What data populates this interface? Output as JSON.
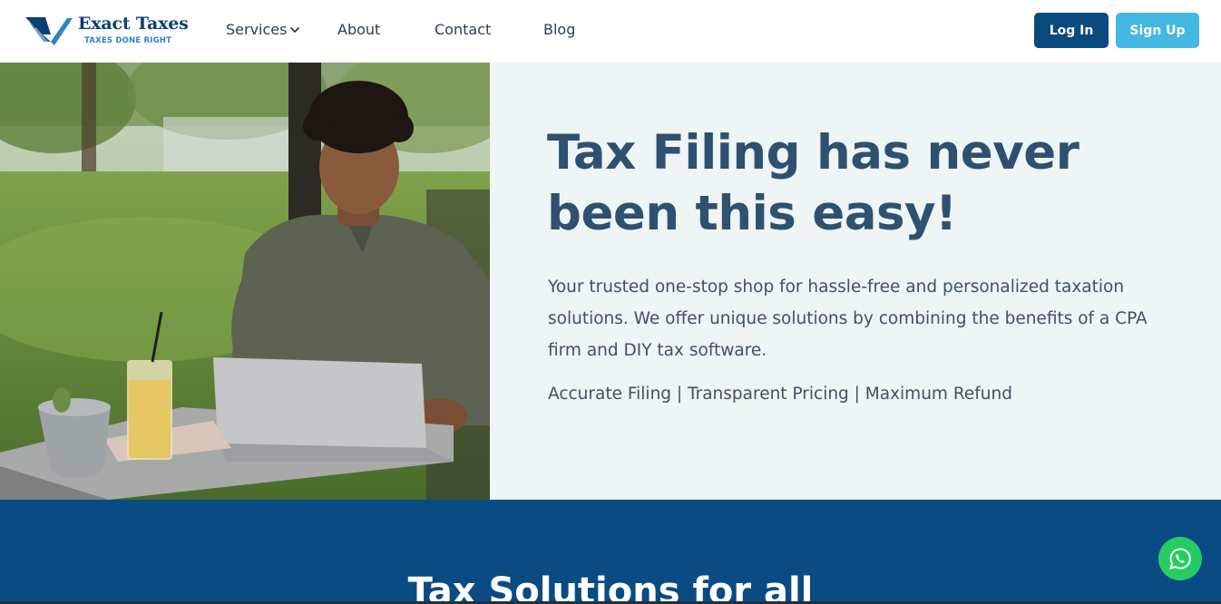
{
  "brand": {
    "name": "Exact Taxes",
    "tagline": "TAXES DONE RIGHT",
    "logo_icon": "checkmark-chevron-logo",
    "color_primary": "#0b3f73",
    "color_accent": "#2b85c5"
  },
  "nav": {
    "items": [
      {
        "label": "Services",
        "has_dropdown": true
      },
      {
        "label": "About"
      },
      {
        "label": "Contact"
      },
      {
        "label": "Blog"
      }
    ],
    "login_label": "Log In",
    "signup_label": "Sign Up",
    "login_color": "#0b4a7e",
    "signup_color": "#42b8e2"
  },
  "hero": {
    "title": "Tax Filing has never been this easy!",
    "description": "Your trusted one-stop shop for hassle-free and personalized taxation solutions. We offer unique solutions by combining the benefits of a CPA firm and DIY tax software.",
    "tagline": "Accurate Filing | Transparent Pricing | Maximum Refund",
    "photo_alt": "young man working on laptop at outdoor cafe table",
    "background": "#eff4f4",
    "title_color": "#2e5171"
  },
  "section": {
    "title": "Tax Solutions for all",
    "background": "#0a4b83"
  },
  "chat": {
    "icon": "whatsapp-icon",
    "color": "#26cc63"
  }
}
